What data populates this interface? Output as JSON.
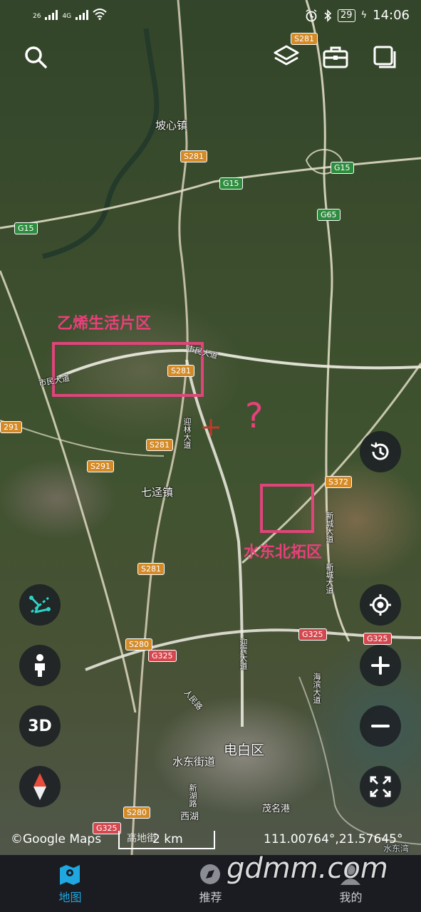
{
  "status_bar": {
    "signal1": "26",
    "signal2": "4G",
    "battery": "29",
    "time": "14:06"
  },
  "map": {
    "place_labels": {
      "poxin": "坡心镇",
      "qitong": "七迳镇",
      "dianbai": "电白区",
      "shuidong_street": "水东街道",
      "xihu": "西湖",
      "maoming_port": "茂名港",
      "shuidong_bay": "水东湾"
    },
    "road_labels": {
      "shichang_rd1": "市民大道",
      "shichang_rd2": "市民大道",
      "yinglin": "迎林大道",
      "xincheng1": "新城大道",
      "xincheng2": "新城大道",
      "haibin": "海滨大道",
      "yingbin": "迎宾大道",
      "renmin": "人民路",
      "xinhu": "新湖路"
    },
    "shields": {
      "s281_top": "S281",
      "s281_poxin": "S281",
      "g15_mid": "G15",
      "g15_right": "G15",
      "g15_left": "G15",
      "g65": "G65",
      "s281_box": "S281",
      "s291_left": "291",
      "s281_mid": "S281",
      "s291_mid": "S291",
      "s372": "S372",
      "s281_low": "S281",
      "g325_right": "G325",
      "s325_far": "G325",
      "s280_a": "S280",
      "g325_left": "G325",
      "s280_b": "S280",
      "g325_bottom": "G325"
    },
    "annotations": {
      "life_zone": "乙烯生活片区",
      "question": "?",
      "north_zone": "水东北拓区"
    },
    "copyright": "©Google Maps",
    "scale": "2 km",
    "scale_hidden_text": "高地街",
    "coordinates": "111.00764°,21.57645°"
  },
  "controls": {
    "threed_label": "3D"
  },
  "tabs": [
    {
      "label": "地图",
      "icon": "map-icon",
      "active": true
    },
    {
      "label": "推荐",
      "icon": "recommend-icon",
      "active": false
    },
    {
      "label": "我的",
      "icon": "profile-icon",
      "active": false
    }
  ],
  "watermark": "gdmm.com",
  "colors": {
    "accent": "#1ea7e0",
    "annotation": "#e8407a",
    "tabbar_bg": "#1a1c22",
    "button_bg": "#1c2024"
  }
}
